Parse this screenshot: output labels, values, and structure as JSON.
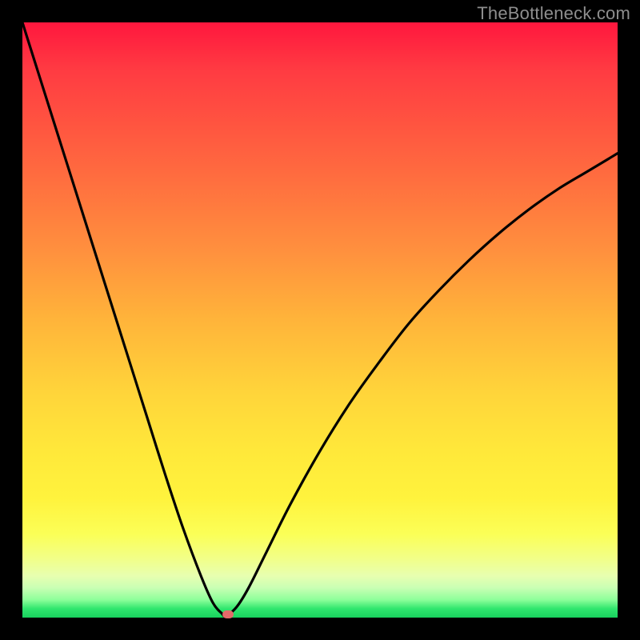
{
  "watermark": "TheBottleneck.com",
  "colors": {
    "frame": "#000000",
    "curve": "#000000",
    "marker": "#e46a6a",
    "gradient_top": "#ff173e",
    "gradient_bottom": "#18d25e"
  },
  "chart_data": {
    "type": "line",
    "title": "",
    "xlabel": "",
    "ylabel": "",
    "xlim": [
      0,
      100
    ],
    "ylim": [
      0,
      100
    ],
    "grid": false,
    "legend": false,
    "annotations": [],
    "series": [
      {
        "name": "bottleneck-curve",
        "x": [
          0,
          3,
          6,
          9,
          12,
          15,
          18,
          21,
          24,
          27,
          30,
          32,
          33.5,
          34.2,
          36,
          38,
          41,
          45,
          50,
          55,
          60,
          65,
          70,
          75,
          80,
          85,
          90,
          95,
          100
        ],
        "y": [
          100,
          90.5,
          81,
          71.5,
          62,
          52.5,
          43,
          33.5,
          24,
          15,
          7,
          2.5,
          0.7,
          0.3,
          1.8,
          5,
          11,
          19,
          28,
          36,
          43,
          49.5,
          55,
          60,
          64.5,
          68.5,
          72,
          75,
          78
        ]
      }
    ],
    "marker": {
      "x": 34.6,
      "y": 0.5
    }
  }
}
